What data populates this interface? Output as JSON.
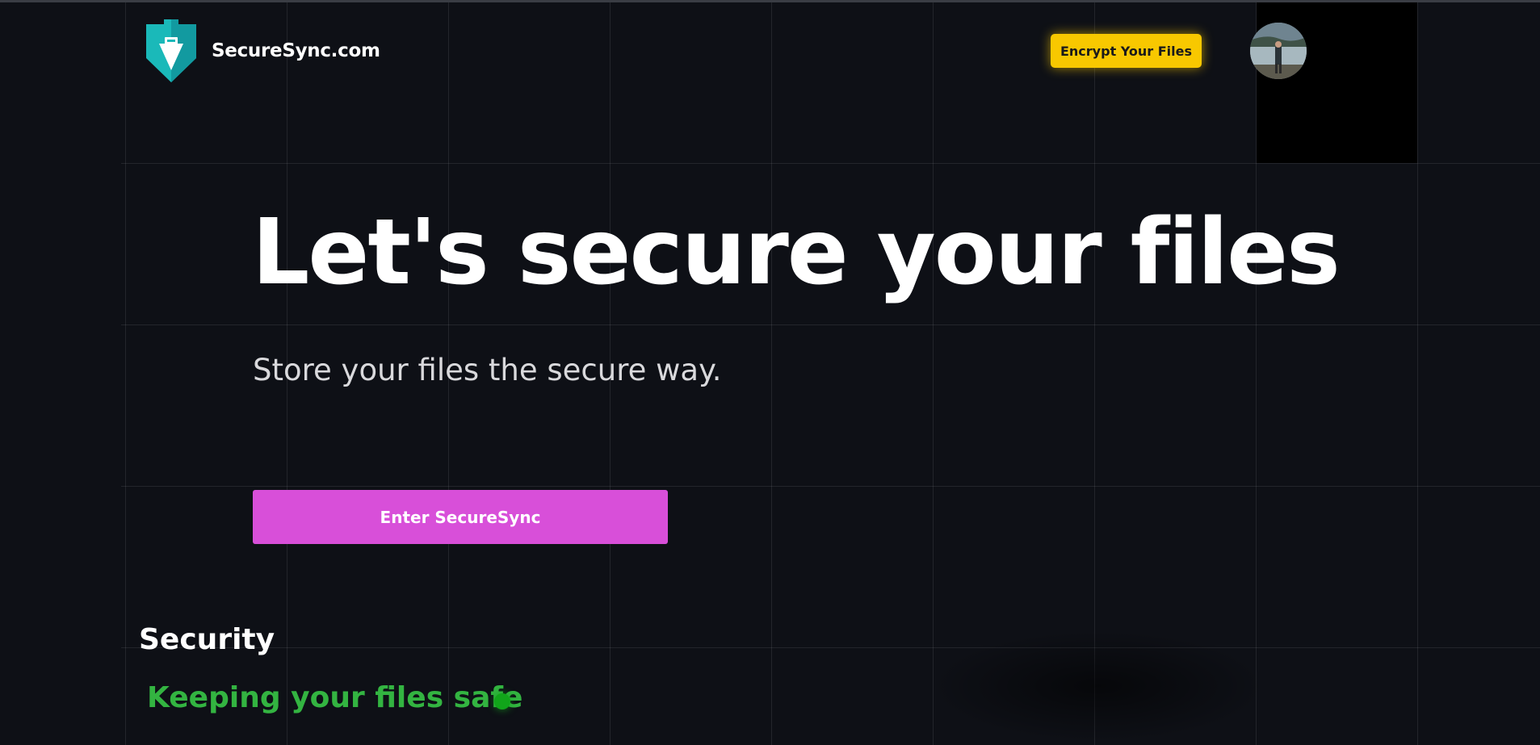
{
  "header": {
    "brand_name": "SecureSync.com",
    "encrypt_button_label": "Encrypt Your Files",
    "logo_icon": "shield-arrow-icon",
    "avatar_icon": "user-avatar-photo"
  },
  "hero": {
    "title": "Let's secure your files",
    "subtitle": "Store your files the secure way.",
    "cta_label": "Enter SecureSync"
  },
  "security": {
    "heading": "Security",
    "status_text": "Keeping your files safe",
    "status_icon": "status-dot-icon"
  },
  "colors": {
    "background": "#0e1016",
    "accent_yellow": "#f8c800",
    "accent_magenta": "#d84fd9",
    "logo_teal": "#1ab9b9",
    "status_green": "#33b441"
  }
}
